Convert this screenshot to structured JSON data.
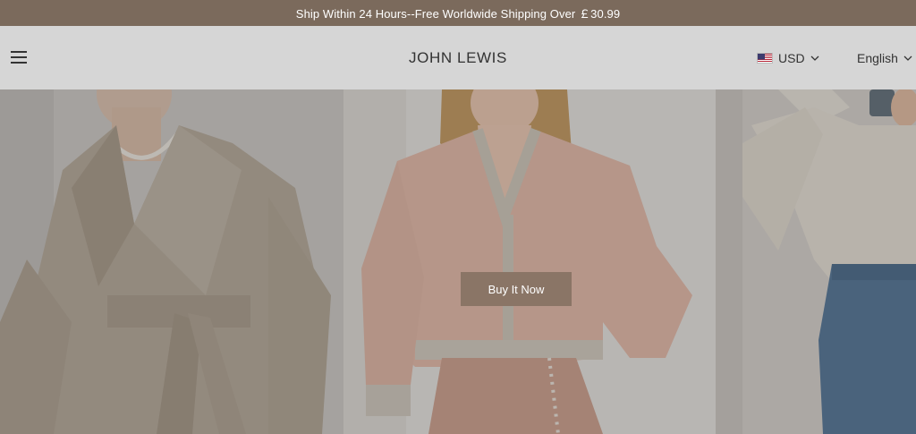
{
  "announcement": {
    "text": "Ship Within 24 Hours--Free Worldwide Shipping Over ￡30.99"
  },
  "header": {
    "logo": "JOHN LEWIS",
    "currency": {
      "flag": "us-flag-icon",
      "label": "USD"
    },
    "language": {
      "label": "English"
    },
    "menu_icon": "hamburger-menu-icon"
  },
  "hero": {
    "panels": [
      {
        "name": "model-beige-wrap-coat"
      },
      {
        "name": "model-pink-cardigan"
      },
      {
        "name": "model-cream-sweater-jeans"
      }
    ],
    "cta_label": "Buy It Now"
  },
  "colors": {
    "announcement_bg": "#7b6a5c",
    "header_bg": "#d6d6d6",
    "cta_bg": "#8a7566"
  }
}
